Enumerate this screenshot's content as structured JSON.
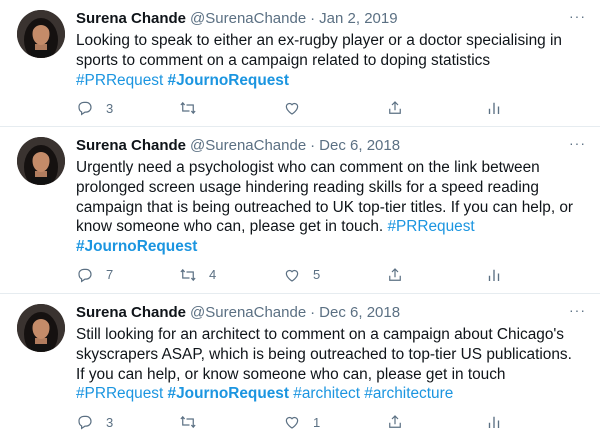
{
  "tweets": [
    {
      "name": "Surena Chande",
      "handle": "@SurenaChande",
      "sep": "·",
      "date": "Jan 2, 2019",
      "more": "···",
      "lines": [
        "Looking to speak to either an ex-rugby player or a doctor specialising in",
        "sports to comment on a campaign related to doping statistics"
      ],
      "tags": [
        "#PRRequest",
        "#JournoRequest"
      ],
      "replies": "3",
      "retweets": "",
      "likes": ""
    },
    {
      "name": "Surena Chande",
      "handle": "@SurenaChande",
      "sep": "·",
      "date": "Dec 6, 2018",
      "more": "···",
      "lines": [
        "Urgently need a psychologist who can comment on the link between",
        "prolonged screen usage hindering reading skills for a speed reading",
        "campaign that is being outreached to UK top-tier titles. If you can help, or",
        "know someone who can, please get in touch."
      ],
      "tags": [
        "#PRRequest",
        "#JournoRequest"
      ],
      "replies": "7",
      "retweets": "4",
      "likes": "5"
    },
    {
      "name": "Surena Chande",
      "handle": "@SurenaChande",
      "sep": "·",
      "date": "Dec 6, 2018",
      "more": "···",
      "lines": [
        "Still looking for an architect to comment on a campaign about Chicago's",
        "skyscrapers ASAP, which is being outreached to top-tier US publications.",
        "If you can help, or know someone who can, please get in touch"
      ],
      "tags": [
        "#PRRequest",
        "#JournoRequest",
        "#architect",
        "#architecture"
      ],
      "replies": "3",
      "retweets": "",
      "likes": "1"
    }
  ],
  "colors": {
    "link": "#1b95e0",
    "muted": "#5b7083",
    "divider": "#e6ecf0"
  },
  "icons": [
    "reply-icon",
    "retweet-icon",
    "like-icon",
    "share-icon",
    "analytics-icon",
    "more-icon"
  ]
}
